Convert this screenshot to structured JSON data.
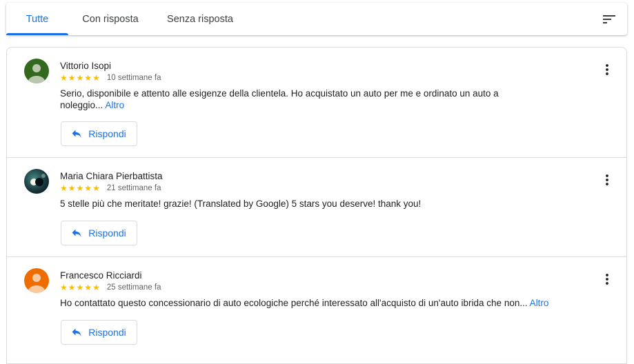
{
  "tabs": [
    {
      "label": "Tutte",
      "active": true
    },
    {
      "label": "Con risposta",
      "active": false
    },
    {
      "label": "Senza risposta",
      "active": false
    }
  ],
  "icons": {
    "sort": "sort-icon",
    "reply": "reply-arrow-icon",
    "menu": "more-vert-icon",
    "star": "star-icon"
  },
  "colors": {
    "accent": "#1a73e8",
    "star": "#fbbc04",
    "avatar_1": "#33691e",
    "avatar_3": "#ef6c00"
  },
  "reviews": [
    {
      "name": "Vittorio Isopi",
      "rating": 5,
      "time": "10 settimane fa",
      "text": "Serio, disponibile e attento alle esigenze della clientela. Ho acquistato un auto per me e ordinato un auto a noleggio...",
      "more_label": "Altro",
      "reply_label": "Rispondi"
    },
    {
      "name": "Maria Chiara Pierbattista",
      "rating": 5,
      "time": "21 settimane fa",
      "text": "5 stelle più che meritate! grazie! (Translated by Google) 5 stars you deserve! thank you!",
      "more_label": "",
      "reply_label": "Rispondi"
    },
    {
      "name": "Francesco Ricciardi",
      "rating": 5,
      "time": "25 settimane fa",
      "text": "Ho contattato questo concessionario di auto ecologiche perché interessato all'acquisto di un'auto ibrida che non...",
      "more_label": "Altro",
      "reply_label": "Rispondi"
    }
  ]
}
